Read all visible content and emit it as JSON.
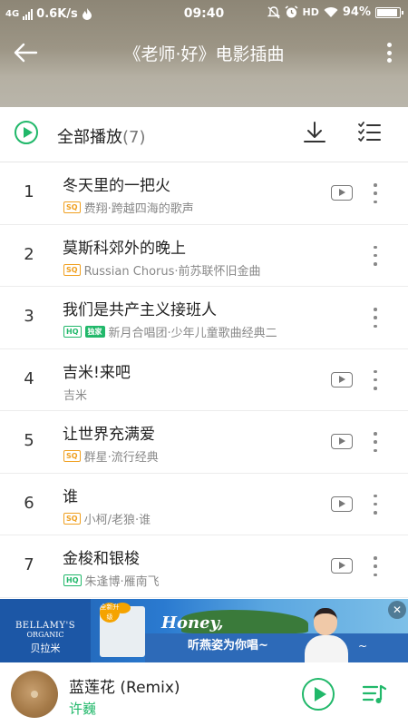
{
  "statusbar": {
    "network": "4G",
    "speed": "0.6K/s",
    "time": "09:40",
    "hd": "HD",
    "battery": "94%"
  },
  "header": {
    "title": "《老师·好》电影插曲"
  },
  "playall": {
    "label": "全部播放",
    "count": "(7)"
  },
  "songs": [
    {
      "index": "1",
      "title": "冬天里的一把火",
      "subtitle": "费翔·跨越四海的歌声",
      "quality": "SQ",
      "exclusive": "",
      "has_mv": true
    },
    {
      "index": "2",
      "title": "莫斯科郊外的晚上",
      "subtitle": "Russian Chorus·前苏联怀旧金曲",
      "quality": "SQ",
      "exclusive": "",
      "has_mv": false
    },
    {
      "index": "3",
      "title": "我们是共产主义接班人",
      "subtitle": "新月合唱团·少年儿童歌曲经典二",
      "quality": "HQ",
      "exclusive": "独家",
      "has_mv": false
    },
    {
      "index": "4",
      "title": "吉米!来吧",
      "subtitle": "吉米",
      "quality": "",
      "exclusive": "",
      "has_mv": true
    },
    {
      "index": "5",
      "title": "让世界充满爱",
      "subtitle": "群星·流行经典",
      "quality": "SQ",
      "exclusive": "",
      "has_mv": true
    },
    {
      "index": "6",
      "title": "谁",
      "subtitle": "小柯/老狼·谁",
      "quality": "SQ",
      "exclusive": "",
      "has_mv": true
    },
    {
      "index": "7",
      "title": "金梭和银梭",
      "subtitle": "朱逢博·雁南飞",
      "quality": "HQ",
      "exclusive": "",
      "has_mv": true
    }
  ],
  "ad": {
    "brand_line1": "BELLAMY'S",
    "brand_line2": "ORGANIC",
    "brand_cn": "贝拉米",
    "badge": "全新升级",
    "headline": "Honey,",
    "slogan": "听燕姿为你唱~",
    "close": "✕"
  },
  "player": {
    "title": "蓝莲花 (Remix)",
    "artist": "许巍"
  },
  "colors": {
    "accent": "#21b86a",
    "sq": "#f0a020"
  }
}
